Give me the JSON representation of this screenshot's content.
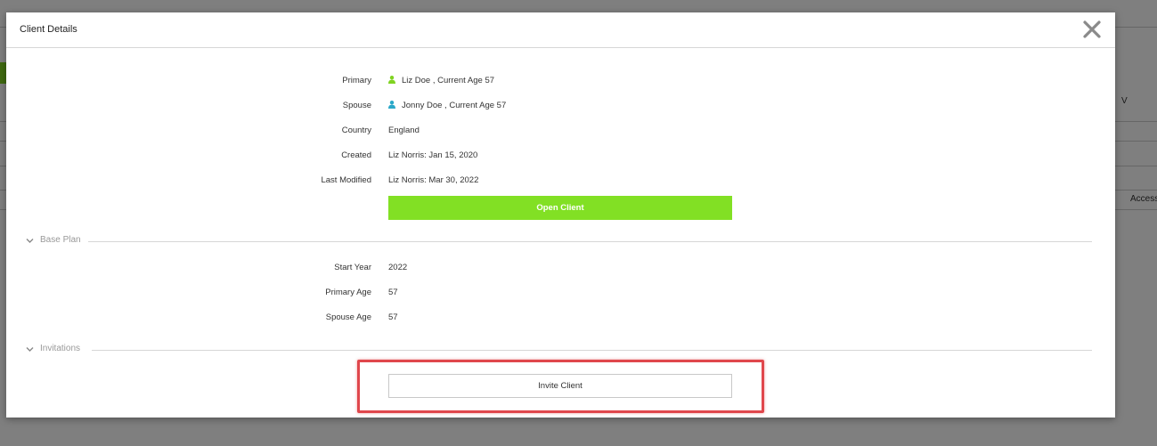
{
  "background": {
    "partial_v": "V",
    "partial_access": "Access"
  },
  "modal": {
    "title": "Client Details",
    "details": [
      {
        "label": "Primary",
        "value": "Liz Doe , Current Age 57",
        "icon": "person-icon-green"
      },
      {
        "label": "Spouse",
        "value": "Jonny Doe , Current Age 57",
        "icon": "person-icon-teal"
      },
      {
        "label": "Country",
        "value": "England"
      },
      {
        "label": "Created",
        "value": "Liz Norris: Jan 15, 2020"
      },
      {
        "label": "Last Modified",
        "value": "Liz Norris: Mar 30, 2022"
      }
    ],
    "open_client_label": "Open Client",
    "base_plan": {
      "section_label": "Base Plan",
      "rows": [
        {
          "label": "Start Year",
          "value": "2022"
        },
        {
          "label": "Primary Age",
          "value": "57"
        },
        {
          "label": "Spouse Age",
          "value": "57"
        }
      ]
    },
    "invitations": {
      "section_label": "Invitations",
      "invite_client_label": "Invite Client"
    }
  },
  "colors": {
    "accent_green": "#82e024",
    "primary_icon": "#7fd321",
    "spouse_icon": "#2aa8c9",
    "highlight": "#e0474c"
  }
}
